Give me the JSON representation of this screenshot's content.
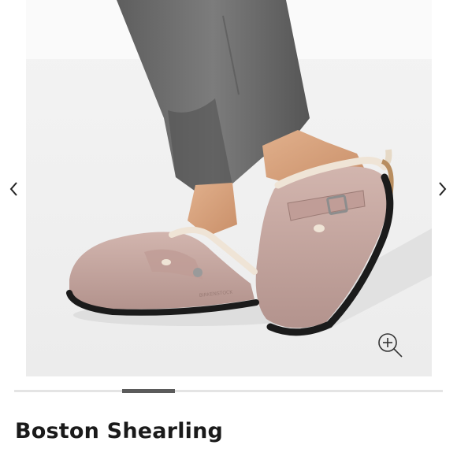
{
  "gallery": {
    "prev_icon": "chevron-left-icon",
    "next_icon": "chevron-right-icon",
    "zoom_icon": "zoom-in-icon",
    "image_subject": "pink suede shearling-lined clogs worn with grey trousers",
    "sole_imprint": "BIRKENSTOCK",
    "colors": {
      "suede": "#c6a8a2",
      "sole": "#1b1b1b",
      "trousers": "#6f6f6f",
      "background": "#f1f1f1",
      "scroll_thumb": "#5b5b5b"
    }
  },
  "product": {
    "title": "Boston Shearling"
  }
}
